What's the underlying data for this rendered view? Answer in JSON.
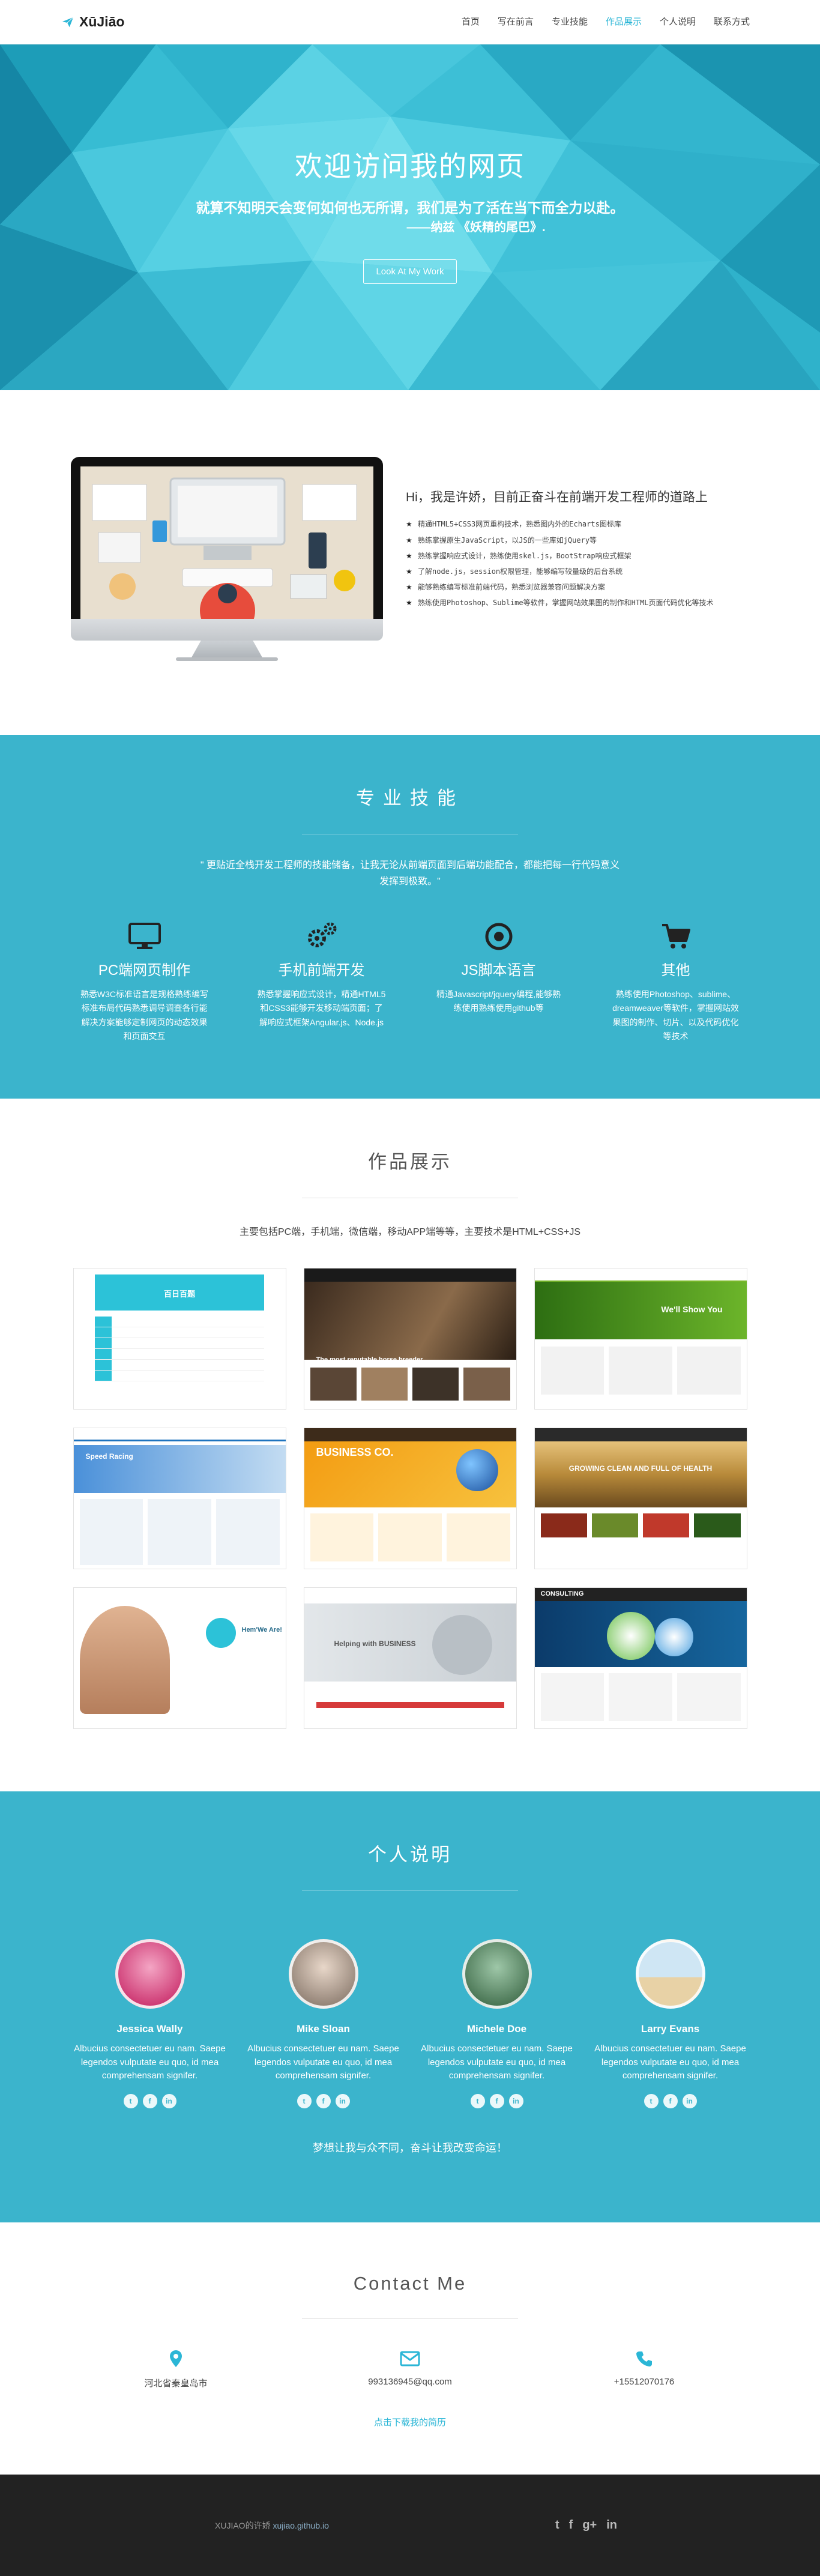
{
  "nav": {
    "brand": "XūJiāo",
    "links": [
      {
        "label": "首页",
        "active": false
      },
      {
        "label": "写在前言",
        "active": false
      },
      {
        "label": "专业技能",
        "active": false
      },
      {
        "label": "作品展示",
        "active": true
      },
      {
        "label": "个人说明",
        "active": false
      },
      {
        "label": "联系方式",
        "active": false
      }
    ]
  },
  "hero": {
    "title": "欢迎访问我的网页",
    "line1": "就算不知明天会变何如何也无所谓，我们是为了活在当下而全力以赴。",
    "quote": "——纳兹 《妖精的尾巴》.",
    "button": "Look At My Work"
  },
  "about": {
    "heading": "Hi，我是许娇，目前正奋斗在前端开发工程师的道路上",
    "items": [
      "精通HTML5+CSS3网页重构技术，熟悉图内外的Echarts图标库",
      "熟练掌握原生JavaScript，以JS的一些库如jQuery等",
      "熟练掌握响应式设计，熟练使用skel.js，BootStrap响应式框架",
      "了解node.js，session权限管理，能够编写较量级的后台系统",
      "能够熟练编写标准前端代码，熟悉浏览器兼容问题解决方案",
      "熟练使用Photoshop、Sublime等软件，掌握网站效果图的制作和HTML页面代码优化等技术"
    ]
  },
  "skills": {
    "title": "专业技能",
    "intro": "\" 更贴近全栈开发工程师的技能储备，让我无论从前端页面到后端功能配合，都能把每一行代码意义发挥到极致。\"",
    "items": [
      {
        "icon": "monitor-icon",
        "title": "PC端网页制作",
        "text": "熟悉W3C标准语言是规格熟练编写标准布局代码熟悉调导调查各行能解决方案能够定制网页的动态效果和页面交互"
      },
      {
        "icon": "gears-icon",
        "title": "手机前端开发",
        "text": "熟悉掌握响应式设计，精通HTML5和CSS3能够开发移动端页面；了解响应式框架Angular.js、Node.js"
      },
      {
        "icon": "target-icon",
        "title": "JS脚本语言",
        "text": "精通Javascript/jquery编程,能够熟练使用熟练使用github等"
      },
      {
        "icon": "cart-icon",
        "title": "其他",
        "text": "熟练使用Photoshop、sublime、dreamweaver等软件，掌握网站效果图的制作、切片、以及代码优化等技术"
      }
    ]
  },
  "works": {
    "title": "作品展示",
    "intro": "主要包括PC端，手机端，微信端，移动APP端等等，主要技术是HTML+CSS+JS",
    "items": [
      {
        "name": "portfolio-thumb-1",
        "caption": "百日百题"
      },
      {
        "name": "portfolio-thumb-2",
        "caption": "The most reputable horse breeder"
      },
      {
        "name": "portfolio-thumb-3",
        "caption": "We'll Show You"
      },
      {
        "name": "portfolio-thumb-4",
        "caption": "Speed Racing"
      },
      {
        "name": "portfolio-thumb-5",
        "caption": "BUSINESS CO."
      },
      {
        "name": "portfolio-thumb-6",
        "caption": "GROWING CLEAN AND FULL OF HEALTH"
      },
      {
        "name": "portfolio-thumb-7",
        "caption": "Hem'We Are!"
      },
      {
        "name": "portfolio-thumb-8",
        "caption": "Helping with BUSINESS"
      },
      {
        "name": "portfolio-thumb-9",
        "caption": "CONSULTING"
      }
    ]
  },
  "team": {
    "title": "个人说明",
    "members": [
      {
        "name": "Jessica Wally",
        "text": "Albucius consectetuer eu nam. Saepe legendos vulputate eu quo, id mea comprehensam signifer."
      },
      {
        "name": "Mike Sloan",
        "text": "Albucius consectetuer eu nam. Saepe legendos vulputate eu quo, id mea comprehensam signifer."
      },
      {
        "name": "Michele Doe",
        "text": "Albucius consectetuer eu nam. Saepe legendos vulputate eu quo, id mea comprehensam signifer."
      },
      {
        "name": "Larry Evans",
        "text": "Albucius consectetuer eu nam. Saepe legendos vulputate eu quo, id mea comprehensam signifer."
      }
    ],
    "motto": "梦想让我与众不同，奋斗让我改变命运！"
  },
  "contact": {
    "title": "Contact Me",
    "items": [
      {
        "icon": "location-icon",
        "text": "河北省秦皇岛市"
      },
      {
        "icon": "mail-icon",
        "text": "993136945@qq.com"
      },
      {
        "icon": "phone-icon",
        "text": "+15512070176"
      }
    ],
    "resume": "点击下载我的简历"
  },
  "footer": {
    "text": "XUJIAO的许娇",
    "link": "xujiao.github.io"
  },
  "colors": {
    "accent": "#2bb6d6",
    "teal": "#3bb4cc",
    "footer": "#222222"
  }
}
